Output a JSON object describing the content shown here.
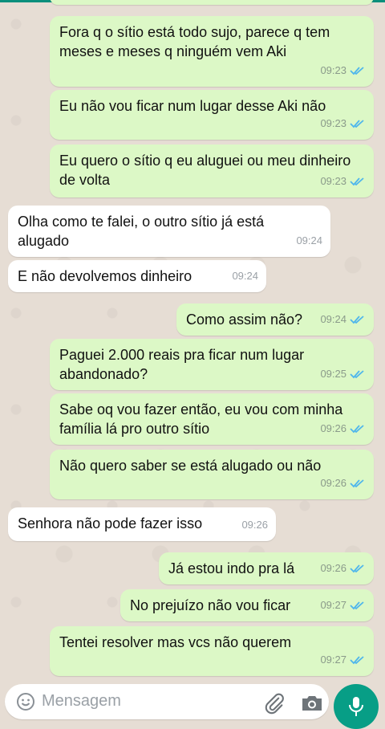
{
  "colors": {
    "outgoing_bubble": "#dcf8c6",
    "incoming_bubble": "#ffffff",
    "read_ticks": "#4fb6ec",
    "mic_button": "#079e86"
  },
  "messages": [
    {
      "direction": "out",
      "text": "Fora q o sítio está todo sujo, parece q tem meses e meses q ninguém vem Aki",
      "time": "09:23",
      "status": "read"
    },
    {
      "direction": "out",
      "text": "Eu não vou ficar num lugar desse Aki não",
      "time": "09:23",
      "status": "read"
    },
    {
      "direction": "out",
      "text": "Eu quero o sítio q eu aluguei ou meu dinheiro de volta",
      "time": "09:23",
      "status": "read"
    },
    {
      "direction": "in",
      "text": "Olha como te falei, o outro sítio já está alugado",
      "time": "09:24"
    },
    {
      "direction": "in",
      "text": "E não devolvemos dinheiro",
      "time": "09:24"
    },
    {
      "direction": "out",
      "text": "Como assim não?",
      "time": "09:24",
      "status": "read"
    },
    {
      "direction": "out",
      "text": "Paguei 2.000 reais pra ficar num lugar abandonado?",
      "time": "09:25",
      "status": "read"
    },
    {
      "direction": "out",
      "text": "Sabe oq vou fazer então, eu vou com minha família lá pro outro sítio",
      "time": "09:26",
      "status": "read"
    },
    {
      "direction": "out",
      "text": "Não quero saber se está alugado ou não",
      "time": "09:26",
      "status": "read"
    },
    {
      "direction": "in",
      "text": "Senhora não pode fazer isso",
      "time": "09:26"
    },
    {
      "direction": "out",
      "text": "Já estou indo pra lá",
      "time": "09:26",
      "status": "read"
    },
    {
      "direction": "out",
      "text": "No prejuízo não vou ficar",
      "time": "09:27",
      "status": "read"
    },
    {
      "direction": "out",
      "text": "Tentei resolver mas vcs não querem",
      "time": "09:27",
      "status": "read"
    }
  ],
  "composer": {
    "placeholder": "Mensagem",
    "emoji_icon": "emoji-icon",
    "attach_icon": "paperclip-icon",
    "camera_icon": "camera-icon",
    "mic_icon": "microphone-icon"
  }
}
